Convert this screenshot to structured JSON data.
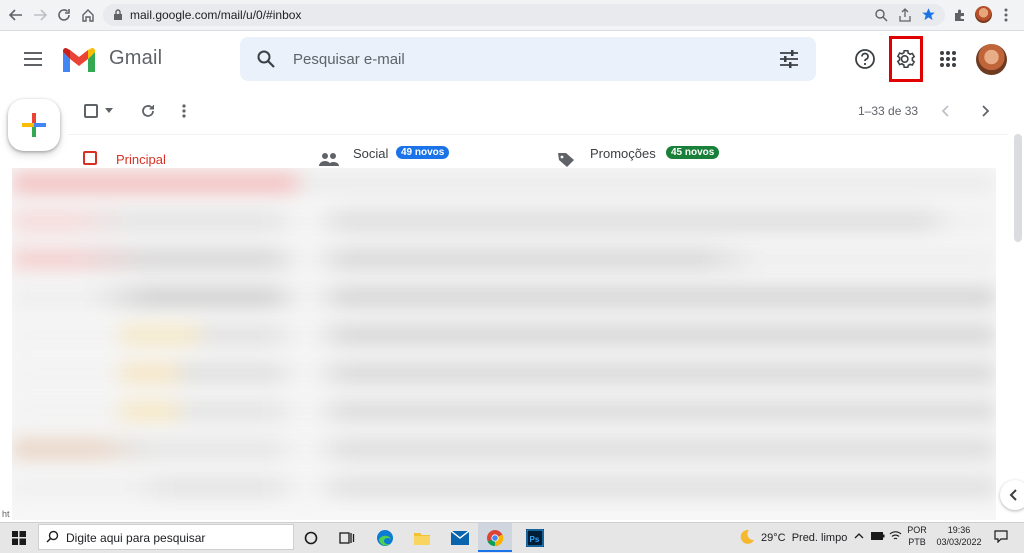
{
  "browser": {
    "url": "mail.google.com/mail/u/0/#inbox"
  },
  "gmail": {
    "wordmark": "Gmail",
    "search": {
      "placeholder": "Pesquisar e-mail"
    }
  },
  "toolbar": {
    "pagination": "1–33 de 33"
  },
  "tabs": [
    {
      "label": "Principal",
      "badge": "",
      "color": "#d93025"
    },
    {
      "label": "Social",
      "badge": "49 novos",
      "badge_color": "#1a73e8"
    },
    {
      "label": "Promoções",
      "badge": "45 novos",
      "badge_color": "#188038"
    }
  ],
  "status_hint": "ht",
  "taskbar": {
    "search_placeholder": "Digite aqui para pesquisar",
    "weather": "29°C  Pred. limpo",
    "lang_top": "POR",
    "lang_bottom": "PTB",
    "time": "19:36",
    "date": "03/03/2022"
  }
}
